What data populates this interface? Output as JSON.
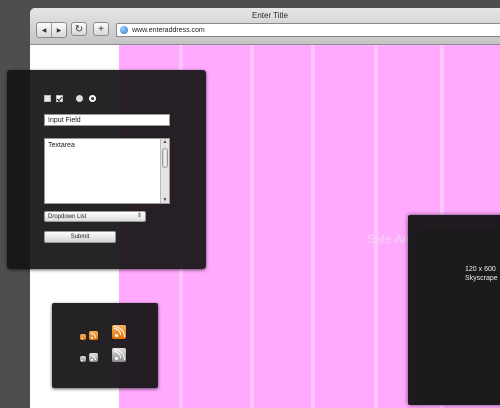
{
  "browser": {
    "title": "Enter Title",
    "url": "www.enteraddress.com",
    "icons": {
      "back": "back-arrow-icon",
      "forward": "forward-arrow-icon",
      "reload": "reload-icon",
      "new_tab": "plus-icon",
      "site": "globe-icon"
    }
  },
  "page": {
    "safe_area_label": "Safe Area for 1024x",
    "colors": {
      "grid_background": "#ffa9ff",
      "grid_lines": "#ffc6ff",
      "panel": "#161416"
    }
  },
  "form": {
    "checkbox_unchecked": {
      "checked": false
    },
    "checkbox_checked": {
      "checked": true
    },
    "radio_unselected": {
      "selected": false
    },
    "radio_selected": {
      "selected": true
    },
    "input_value": "Input Field",
    "textarea_value": "Textarea",
    "dropdown_value": "Dropdown List",
    "submit_label": "Submit"
  },
  "rss": {
    "rows": [
      {
        "color": "orange",
        "icon": "rss-icon",
        "sizes": [
          "small",
          "medium",
          "large"
        ]
      },
      {
        "color": "gray",
        "icon": "rss-icon",
        "sizes": [
          "small",
          "medium",
          "large"
        ]
      }
    ]
  },
  "ad": {
    "size_label": "120 x 600",
    "type_label": "Skyscrape"
  }
}
